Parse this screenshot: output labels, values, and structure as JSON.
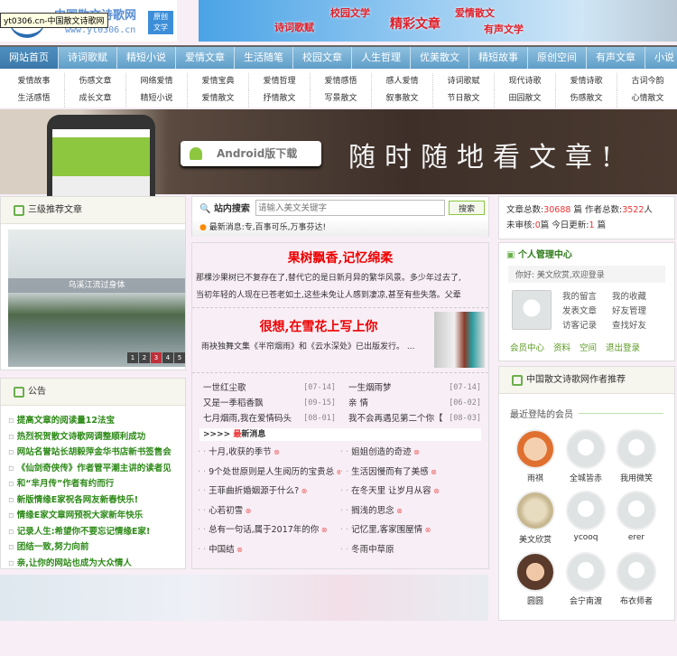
{
  "tooltip": "yt0306.cn-中国散文诗歌网",
  "logo": {
    "name": "中国散文诗歌网",
    "url": "www.yt0306.cn",
    "badge1": "原创",
    "badge2": "文学"
  },
  "top_banner": [
    "诗词歌赋",
    "校园文学",
    "精彩文章",
    "爱情散文",
    "有声文学"
  ],
  "nav": [
    "网站首页",
    "诗词歌赋",
    "精短小说",
    "爱情文章",
    "生活随笔",
    "校园文章",
    "人生哲理",
    "优美散文",
    "精短故事",
    "原创空间",
    "有声文章",
    "小说"
  ],
  "subnav": [
    "爱情故事",
    "伤感文章",
    "网络爱情",
    "爱情宝典",
    "爱情哲理",
    "爱情感悟",
    "感人爱情",
    "诗词歌赋",
    "现代诗歌",
    "爱情诗歌",
    "古词今韵",
    "生活感悟",
    "成长文章",
    "精短小说",
    "爱情散文",
    "抒情散文",
    "写景散文",
    "叙事散文",
    "节日散文",
    "田园散文",
    "伤感散文",
    "心情散文"
  ],
  "ad": {
    "android": "Android版下载",
    "slogan": "随时随地看文章!"
  },
  "recommend": {
    "title": "三级推荐文章",
    "caption": "乌溪江流过身体",
    "pages": [
      "1",
      "2",
      "3",
      "4",
      "5"
    ],
    "active_page": "3"
  },
  "notice": {
    "title": "公告",
    "items": [
      "提高文章的阅读量12法宝",
      "热烈祝贺散文诗歌网调整顺利成功",
      "网站名誉站长胡毅萍金华书店新书签售会",
      "《仙剑奇侠传》作者管平潮主讲的读者见",
      "和“芈月传”作者有约而行",
      "新版情缘E家祝各网友新春快乐!",
      "情缘E家文章网预祝大家新年快乐",
      "记录人生:希望你不要忘记情缘E家!",
      "团结一致,努力向前",
      "亲,让你的网站也成为大众情人"
    ]
  },
  "search": {
    "label": "站内搜索",
    "placeholder": "请输入美文关键字",
    "button": "搜索",
    "news": "最新消息:专,百事可乐,万事芬达!"
  },
  "featured": [
    {
      "title": "果树飘香,记忆绵柔",
      "summary1": "那棵沙果树已不复存在了,替代它的是日新月异的繁华风景。多少年过去了,",
      "summary2": "当初年轻的人现在已苍老如土,这些未免让人感到凄凉,甚至有些失落。父辈"
    },
    {
      "title": "很想,在雪花上写上你",
      "summary": "雨袂独舞文集《半帘烟雨》和《云水深处》已出版发行。 ..."
    }
  ],
  "dated": [
    {
      "t": "一世红尘歌",
      "d": "[07-14]"
    },
    {
      "t": "一生烟雨梦",
      "d": "[07-14]"
    },
    {
      "t": "又是一季稻香飘",
      "d": "[09-15]"
    },
    {
      "t": "亲 情",
      "d": "[06-02]"
    },
    {
      "t": "七月烟雨,我在爱情码头",
      "d": "[08-01]"
    },
    {
      "t": "我不会再遇见第二个你【",
      "d": "[08-03]"
    }
  ],
  "latest": {
    "prefix": ">>>>",
    "first": "最",
    "rest": "新消息",
    "items": [
      "十月,收获的季节",
      "姐姐创造的奇迹",
      "9个处世原则是人生阅历的宝贵总",
      "生活因慢而有了美感",
      "王菲曲折婚姻源于什么?",
      "在冬天里 让岁月从容",
      "心若初雪",
      "搁浅的思念",
      "总有一句话,属于2017年的你",
      "记忆里,客家围屋情",
      "中国结",
      "冬雨中草原"
    ]
  },
  "stats": {
    "articles_label": "文章总数:",
    "articles": "30688",
    "articles_unit": "篇",
    "authors_label": "作者总数:",
    "authors": "3522",
    "authors_unit": "人",
    "pending_label": "未审核:",
    "pending": "0",
    "pending_unit": "篇",
    "today_label": "今日更新:",
    "today": "1",
    "today_unit": "篇"
  },
  "ucenter": {
    "title": "个人管理中心",
    "greeting": "你好: 美文欣赏,欢迎登录",
    "links": [
      "我的留言",
      "我的收藏",
      "发表文章",
      "好友管理",
      "访客记录",
      "查找好友"
    ],
    "bottom": [
      "会员中心",
      "资料",
      "空间",
      "退出登录"
    ]
  },
  "authors": {
    "title": "中国散文诗歌网作者推荐",
    "subtitle": "最近登陆的会员",
    "members": [
      "雨祺",
      "全城皆赤",
      "我用微笑",
      "美文欣赏",
      "ycooq",
      "erer",
      "圆圆",
      "会宁南渡",
      "布衣师者"
    ]
  }
}
